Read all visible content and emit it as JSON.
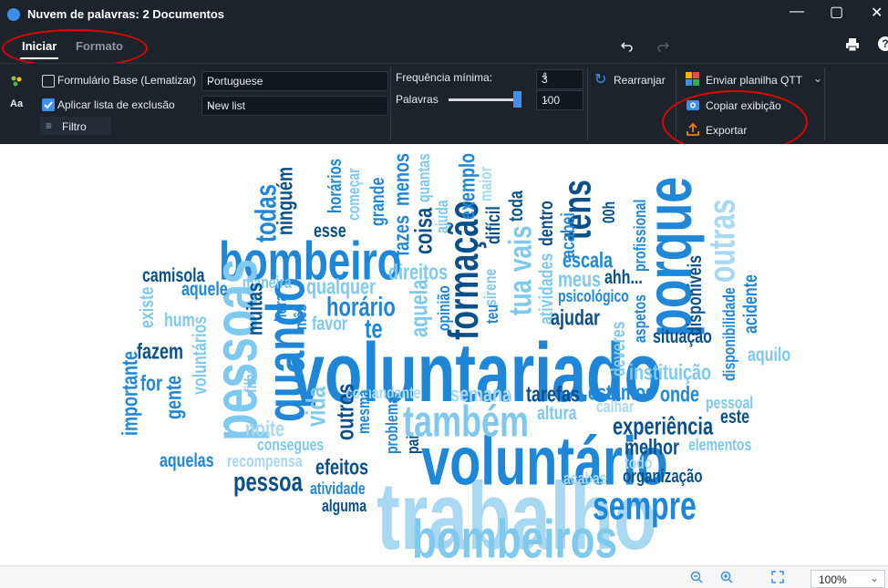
{
  "window": {
    "title": "Nuvem de palavras: 2 Documentos"
  },
  "tabs": [
    {
      "label": "Iniciar"
    },
    {
      "label": "Formato"
    }
  ],
  "ribbon": {
    "lemmatize_label": "Formulário Base (Lematizar)",
    "language_value": "Portuguese",
    "exclusion_label": "Aplicar lista de exclusão",
    "exclusion_list_value": "New list",
    "filter_label": "Filtro",
    "min_freq_label": "Frequência mínima:",
    "min_freq_value": "3",
    "words_label": "Palavras",
    "words_value": "100",
    "rearrange_label": "Rearranjar",
    "send_label": "Enviar planilha QTT",
    "copy_label": "Copiar exibição",
    "export_label": "Exportar",
    "words_slider_level": 1.0
  },
  "colors": {
    "dark": "#0a4f8a",
    "mid": "#1f86d8",
    "light": "#7fc8ee",
    "pale": "#a8d8f2",
    "annotation": "#e00000"
  },
  "cloud_words": [
    "voluntariado",
    "trabalho",
    "voluntário",
    "bombeiro",
    "pessoas",
    "bombeiros",
    "também",
    "porque",
    "sempre",
    "formação",
    "quando",
    "tua",
    "vais",
    "tens",
    "experiência",
    "organização",
    "pessoa",
    "horário",
    "instituição",
    "vida",
    "outros",
    "te",
    "todas",
    "esse",
    "ninguém",
    "horários",
    "começar",
    "grande",
    "fazes",
    "menos",
    "coisa",
    "quantas",
    "ajuda",
    "exemplo",
    "maior",
    "difícil",
    "toda",
    "dentro",
    "acabei",
    "00h",
    "profissional",
    "disponíveis",
    "outras",
    "escala",
    "meus",
    "ahh...",
    "psicológico",
    "direitos",
    "camisola",
    "aquele",
    "maneira",
    "qualquer",
    "existe",
    "hum",
    "muitas",
    "hora",
    "mês",
    "favor",
    "aquela",
    "opinião",
    "teu",
    "sirene",
    "atividades",
    "ajudar",
    "aspetos",
    "situação",
    "disponibilidade",
    "acidente",
    "aquilo",
    "fazem",
    "voluntários",
    "importante",
    "gente",
    "for",
    "filho",
    "deveres",
    "comandante",
    "semana",
    "tarefas",
    "estamos",
    "onde",
    "pessoal",
    "este",
    "calhar",
    "altura",
    "noite",
    "consegues",
    "mesma",
    "problema",
    "pai",
    "melhor",
    "elementos",
    "todo",
    "acabas",
    "aquelas",
    "recompensa",
    "efeitos",
    "atividade",
    "alguma"
  ],
  "status": {
    "zoom": "100%"
  }
}
